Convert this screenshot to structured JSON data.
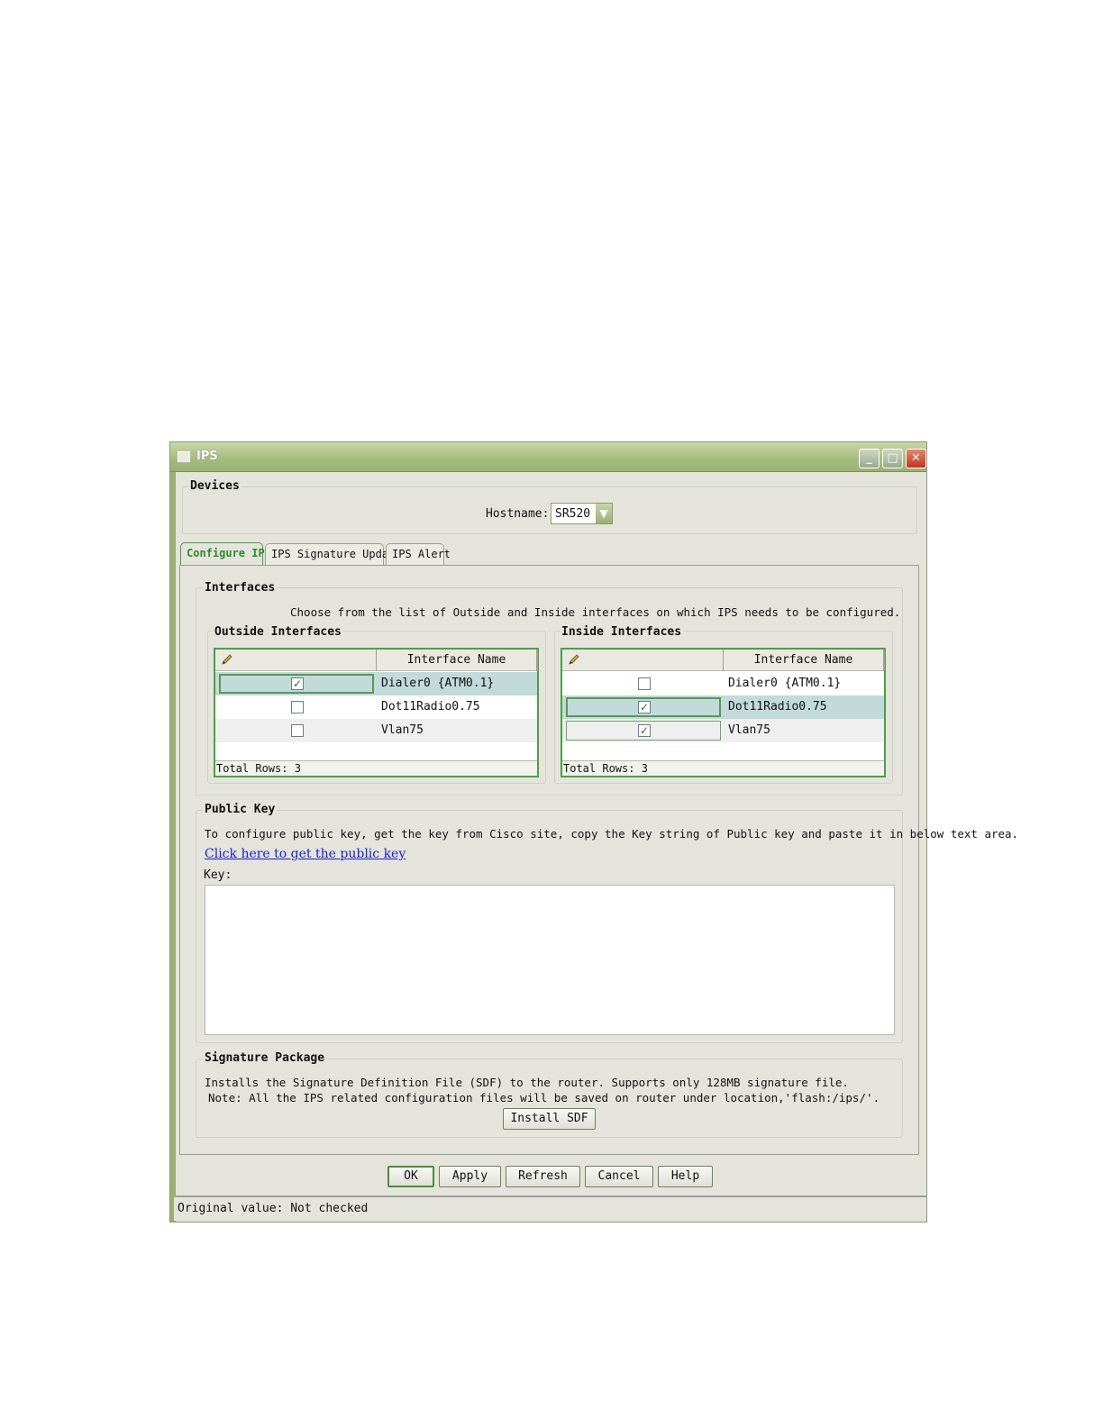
{
  "window": {
    "title": "IPS"
  },
  "devices": {
    "legend": "Devices",
    "hostname_label": "Hostname:",
    "hostname_value": "SR520"
  },
  "tabs": [
    {
      "label": "Configure IPS",
      "active": true
    },
    {
      "label": "IPS Signature Update",
      "active": false
    },
    {
      "label": "IPS Alert",
      "active": false
    }
  ],
  "interfaces": {
    "legend": "Interfaces",
    "instruction": "Choose from the list of Outside and Inside interfaces on which IPS needs to be configured.",
    "outside": {
      "legend": "Outside Interfaces",
      "column_header": "Interface Name",
      "rows": [
        {
          "name": "Dialer0 {ATM0.1}",
          "checked": true
        },
        {
          "name": "Dot11Radio0.75",
          "checked": false
        },
        {
          "name": "Vlan75",
          "checked": false
        }
      ],
      "total_rows": "Total Rows: 3"
    },
    "inside": {
      "legend": "Inside Interfaces",
      "column_header": "Interface Name",
      "rows": [
        {
          "name": "Dialer0 {ATM0.1}",
          "checked": false
        },
        {
          "name": "Dot11Radio0.75",
          "checked": true
        },
        {
          "name": "Vlan75",
          "checked": true
        }
      ],
      "total_rows": "Total Rows: 3"
    }
  },
  "public_key": {
    "legend": "Public Key",
    "instruction": "To configure public key, get the key from Cisco site, copy the Key string of Public key and paste it in below text area.",
    "link": "Click here to get the public key",
    "key_label": "Key:",
    "key_value": ""
  },
  "signature_package": {
    "legend": "Signature Package",
    "line1": "Installs the Signature Definition File (SDF) to the router. Supports only 128MB signature file.",
    "line2": "Note: All the IPS related configuration files will be saved on router under location,'flash:/ips/'.",
    "install_button": "Install SDF"
  },
  "buttons": {
    "ok": "OK",
    "apply": "Apply",
    "refresh": "Refresh",
    "cancel": "Cancel",
    "help": "Help"
  },
  "status": "Original value: Not checked",
  "checkmark": "✓",
  "icons": {
    "titlebar": "window-icon",
    "column": "pencil-icon"
  },
  "colors": {
    "titlebar": "#a8bc82",
    "accent": "#4aa046",
    "link": "#1a22c6",
    "selected_row": "#c2dada"
  }
}
